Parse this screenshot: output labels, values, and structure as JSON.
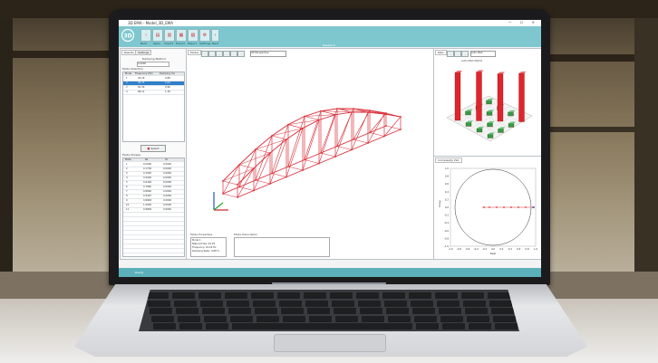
{
  "app": {
    "title": "3D EMA - Model_3D_EMA",
    "window_buttons": "— ☐ ✕",
    "ribbon_title": "Research",
    "status_text": "Ready",
    "logo_text": "3D"
  },
  "ribbon": {
    "buttons": [
      {
        "icon": "back-icon",
        "label": "Back",
        "glyph": "‹"
      },
      {
        "icon": "open-icon",
        "label": "Open",
        "glyph": "▤"
      },
      {
        "icon": "import-icon",
        "label": "Import",
        "glyph": "▥"
      },
      {
        "icon": "export-icon",
        "label": "Export",
        "glyph": "▦"
      },
      {
        "icon": "report-icon",
        "label": "Report",
        "glyph": "▧"
      },
      {
        "icon": "settings-icon",
        "label": "Settings",
        "glyph": "⚙"
      },
      {
        "icon": "forward-icon",
        "label": "Next",
        "glyph": "›"
      }
    ]
  },
  "left_panel": {
    "tabs": [
      "Results",
      "Settings"
    ],
    "damping_label": "Damping Method",
    "damping_value": "0.0000",
    "mode_list_label": "Mode Selection",
    "mode_headers": [
      "Mode",
      "Frequency (Hz)",
      "Damping (%)"
    ],
    "modes": [
      [
        "1",
        "24.18",
        "0.88"
      ],
      [
        "2",
        "45.71",
        "1.04"
      ],
      [
        "3",
        "62.56",
        "0.96"
      ],
      [
        "4",
        "88.12",
        "1.38"
      ]
    ],
    "mode_button": "Select",
    "shapes_label": "Mode Shapes",
    "shape_headers": [
      "Node",
      "Re",
      "Im"
    ],
    "shapes": [
      [
        "1",
        "0.0000",
        "0.0000"
      ],
      [
        "2",
        "0.1736",
        "0.0000"
      ],
      [
        "3",
        "0.3420",
        "0.0000"
      ],
      [
        "4",
        "0.5000",
        "0.0000"
      ],
      [
        "5",
        "0.6428",
        "0.0000"
      ],
      [
        "6",
        "0.7660",
        "0.0000"
      ],
      [
        "7",
        "0.8660",
        "0.0000"
      ],
      [
        "8",
        "0.9397",
        "0.0000"
      ],
      [
        "9",
        "0.9848",
        "0.0000"
      ],
      [
        "10",
        "1.0000",
        "0.0000"
      ],
      [
        "11",
        "0.9848",
        "0.0000"
      ]
    ]
  },
  "center_panel": {
    "tab": "Model",
    "view_select": "3D Perspective",
    "mode_props_label": "Mode Properties",
    "mode_props": [
      "Mode 1",
      "Natural Freq: 24.18",
      "Frequency: 24.18 Hz",
      "Damping Ratio: 0.88 %"
    ],
    "description_label": "Mode Description"
  },
  "right_top": {
    "tab": "MAC",
    "select": "Auto MAC",
    "chart_title": "Auto MAC Matrix"
  },
  "right_bottom": {
    "tab": "Complexity Plot",
    "yaxis_label": "Imag",
    "xaxis_label": "Real",
    "y_ticks": [
      "1.0",
      "0.8",
      "0.6",
      "0.4",
      "0.2",
      "0.0",
      "-0.2",
      "-0.4",
      "-0.6",
      "-0.8",
      "-1.0"
    ],
    "x_ticks": [
      "-1.0",
      "-0.8",
      "-0.6",
      "-0.4",
      "-0.2",
      "0.0",
      "0.2",
      "0.4",
      "0.6",
      "0.8",
      "1.0"
    ]
  },
  "colors": {
    "accent": "#7fc7cf",
    "truss": "#d9303a",
    "mac_high": "#e0242c",
    "mac_low": "#2f9e44"
  }
}
